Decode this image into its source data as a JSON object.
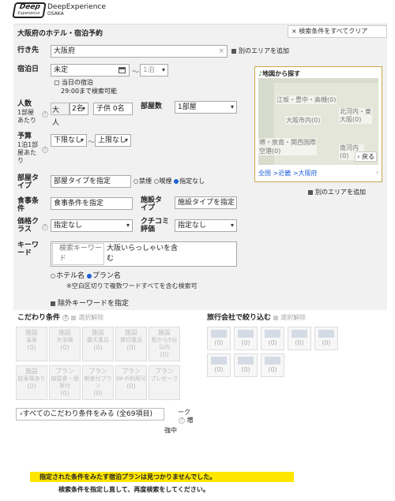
{
  "header": {
    "brand_top": "Deep",
    "brand_bottom": "Experience",
    "brand_name": "DeepExperience",
    "city": "OSAKA"
  },
  "search": {
    "title": "大阪府のホテル・宿泊予約",
    "clear_all": "× 検索条件をすべてクリア",
    "destination": {
      "label": "行き先",
      "value": "大阪府",
      "add_area": "別のエリアを追加"
    },
    "checkin": {
      "label": "宿泊日",
      "value": "未定",
      "tilde": "〜",
      "nights": "1泊",
      "sameday": "当日の宿泊",
      "sameday_note": "29:00まで検索可能"
    },
    "people": {
      "label": "人数",
      "sub": "1部屋あたり",
      "adult_unit": "大人",
      "adult": "2名",
      "child": "子供 0名"
    },
    "rooms": {
      "label": "部屋数",
      "value": "1部屋"
    },
    "budget": {
      "label": "予算",
      "sub": "1泊1部屋あたり",
      "min": "下限なし",
      "tilde": "〜",
      "max": "上限なし"
    },
    "room_type": {
      "label": "部屋タイプ",
      "value": "部屋タイプを指定",
      "smoke_options": [
        "禁煙",
        "喫煙",
        "指定なし"
      ],
      "smoke_selected": 2
    },
    "meal": {
      "label": "食事条件",
      "value": "食事条件を指定"
    },
    "facility_type": {
      "label": "施設タイプ",
      "value": "施設タイプを指定"
    },
    "price_class": {
      "label": "価格クラス",
      "value": "指定なし"
    },
    "review": {
      "label": "クチコミ評価",
      "value": "指定なし"
    },
    "keyword": {
      "label": "キーワード",
      "placeholder": "検索キーワード",
      "value": "大阪いらっしゃいを含む",
      "options": [
        "ホテル名",
        "プラン名"
      ],
      "selected": 1,
      "note": "※空白区切りで複数ワードすべてを含む検索可",
      "exclude": "除外キーワードを指定"
    }
  },
  "map": {
    "title": "地図から探す",
    "regions": [
      "江坂・豊中・高槻(0)",
      "大阪市内(0)",
      "北河内・東大阪(0)",
      "堺・泉南・関西国際空港(0)",
      "南河内(0)"
    ],
    "back": "戻る",
    "breadcrumb": "全国 >近畿 >大阪府",
    "add_area": "別のエリアを追加"
  },
  "kodawari": {
    "title": "こだわり条件",
    "clear": "選択解除",
    "tiles": [
      {
        "l1": "施設",
        "l2": "温泉",
        "c": "(0)"
      },
      {
        "l1": "施設",
        "l2": "大浴場",
        "c": "(0)"
      },
      {
        "l1": "施設",
        "l2": "露天風呂",
        "c": "(0)"
      },
      {
        "l1": "施設",
        "l2": "貸切風呂",
        "c": "(0)"
      },
      {
        "l1": "施設",
        "l2": "駅から5分以内",
        "c": "(0)"
      },
      {
        "l1": "施設",
        "l2": "駐車場あり",
        "c": "(0)"
      },
      {
        "l1": "プラン",
        "l2": "部屋食・個室付",
        "c": "(0)"
      },
      {
        "l1": "プラン",
        "l2": "朝食付プラン",
        "c": "(0)"
      },
      {
        "l1": "プラン",
        "l2": "Wi-Fi利用可",
        "c": "(0)"
      },
      {
        "l1": "プラン",
        "l2": "プレゼーク",
        "c": ""
      }
    ],
    "see_all": "すべてのこだわり条件をみる (全69項目)",
    "overflow": "ーク",
    "overflow2": "増",
    "overflow3": "強中"
  },
  "agency": {
    "title": "旅行会社で絞り込む",
    "clear": "選択解除",
    "counts": [
      "(0)",
      "(0)",
      "(0)",
      "(0)",
      "(0)",
      "(0)",
      "(0)",
      "(0)"
    ]
  },
  "result": {
    "message": "指定された条件をみたす宿泊プランは見つかりませんでした。",
    "hint": "検索条件を指定し直して、再度検索をしてください。"
  }
}
